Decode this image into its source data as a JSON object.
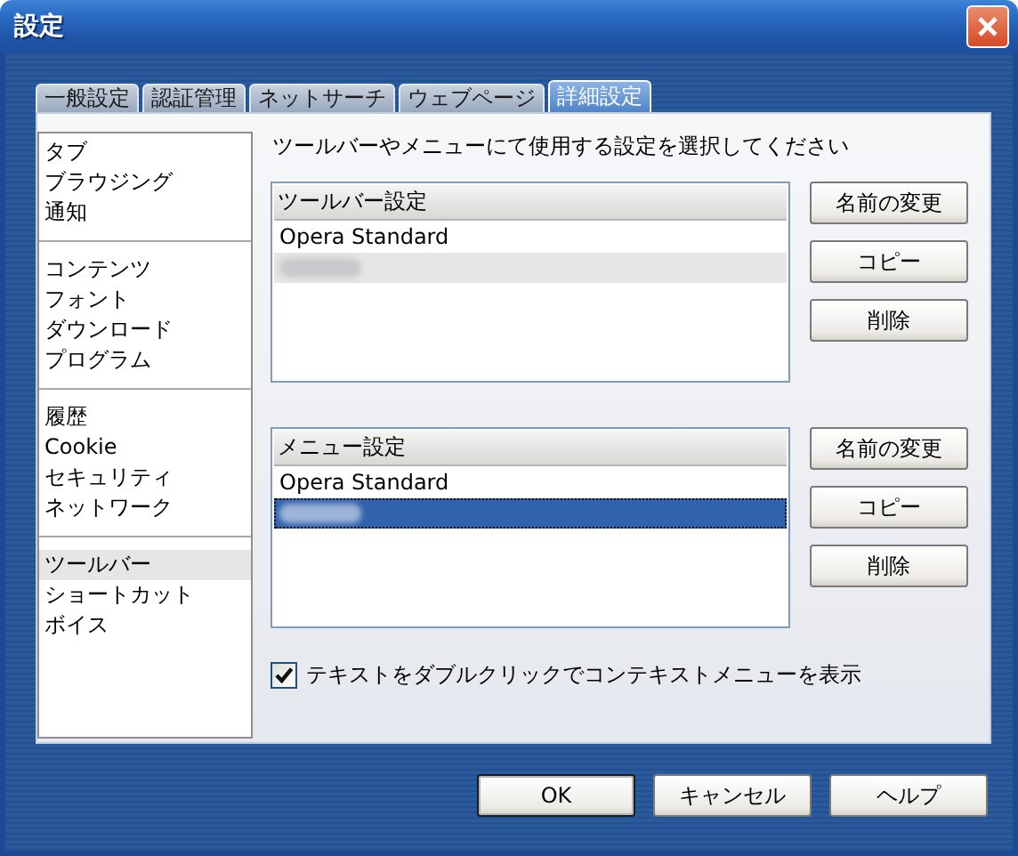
{
  "window": {
    "title": "設定"
  },
  "tabs": [
    {
      "label": "一般設定",
      "selected": false
    },
    {
      "label": "認証管理",
      "selected": false
    },
    {
      "label": "ネットサーチ",
      "selected": false
    },
    {
      "label": "ウェブページ",
      "selected": false
    },
    {
      "label": "詳細設定",
      "selected": true
    }
  ],
  "sidebar": {
    "groups": [
      {
        "items": [
          {
            "label": "タブ",
            "selected": false
          },
          {
            "label": "ブラウジング",
            "selected": false
          },
          {
            "label": "通知",
            "selected": false
          }
        ]
      },
      {
        "items": [
          {
            "label": "コンテンツ",
            "selected": false
          },
          {
            "label": "フォント",
            "selected": false
          },
          {
            "label": "ダウンロード",
            "selected": false
          },
          {
            "label": "プログラム",
            "selected": false
          }
        ]
      },
      {
        "items": [
          {
            "label": "履歴",
            "selected": false
          },
          {
            "label": "Cookie",
            "selected": false
          },
          {
            "label": "セキュリティ",
            "selected": false
          },
          {
            "label": "ネットワーク",
            "selected": false
          }
        ]
      },
      {
        "items": [
          {
            "label": "ツールバー",
            "selected": true
          },
          {
            "label": "ショートカット",
            "selected": false
          },
          {
            "label": "ボイス",
            "selected": false
          }
        ]
      }
    ]
  },
  "instruction": "ツールバーやメニューにて使用する設定を選択してください",
  "setups": [
    {
      "header": "ツールバー設定",
      "focused": false,
      "rows": [
        {
          "kind": "text",
          "text": "Opera Standard",
          "selected": false
        },
        {
          "kind": "redacted",
          "selected": true
        }
      ],
      "buttons": [
        "名前の変更",
        "コピー",
        "削除"
      ]
    },
    {
      "header": "メニュー設定",
      "focused": true,
      "rows": [
        {
          "kind": "text",
          "text": "Opera Standard",
          "selected": false
        },
        {
          "kind": "redacted",
          "selected": true
        }
      ],
      "buttons": [
        "名前の変更",
        "コピー",
        "削除"
      ]
    }
  ],
  "option": {
    "label": "テキストをダブルクリックでコンテキストメニューを表示",
    "checked": true
  },
  "buttons": [
    {
      "label": "OK",
      "default": true
    },
    {
      "label": "キャンセル",
      "default": false
    },
    {
      "label": "ヘルプ",
      "default": false
    }
  ]
}
